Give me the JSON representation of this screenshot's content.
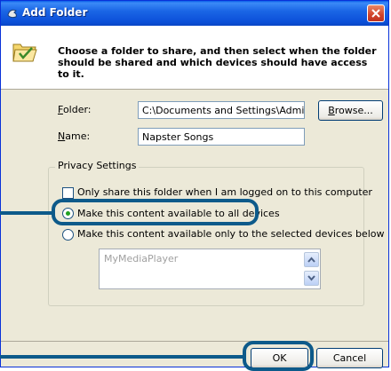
{
  "window": {
    "title": "Add Folder",
    "close_icon": "close-icon"
  },
  "header": {
    "icon": "folder-check-icon",
    "instruction": "Choose a folder to share, and then select when the folder should be shared and which devices should have access to it."
  },
  "form": {
    "folder_label_key": "F",
    "folder_label_rest": "older:",
    "folder_value": "C:\\Documents and Settings\\Administrat",
    "browse_key": "B",
    "browse_rest": "rowse...",
    "name_label_key": "N",
    "name_label_rest": "ame:",
    "name_value": "Napster Songs"
  },
  "privacy": {
    "group_title": "Privacy Settings",
    "logged_on_checkbox": {
      "label": "Only share this folder when I am logged on to this computer",
      "checked": false
    },
    "all_devices_radio": {
      "label": "Make this content available to all devices",
      "selected": true
    },
    "selected_devices_radio": {
      "label": "Make this content available only to the selected devices below",
      "selected": false
    },
    "devices": [
      "MyMediaPlayer"
    ]
  },
  "footer": {
    "ok_label": "OK",
    "cancel_label": "Cancel"
  },
  "colors": {
    "titlebar": "#0b4fd8",
    "dialog_bg": "#ece9d8",
    "callout": "#0d5a8a"
  }
}
